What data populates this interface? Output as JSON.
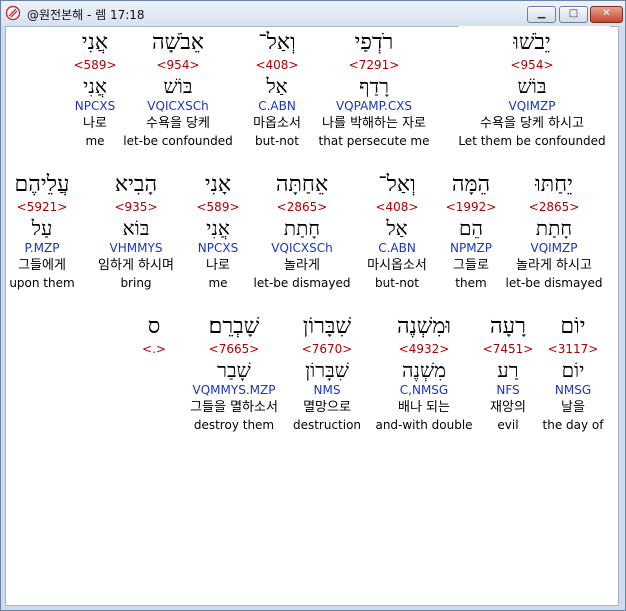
{
  "window": {
    "title": "@원전본해 - 렘 17:18",
    "minimize": "▁",
    "maximize": "□",
    "close": "✕"
  },
  "rows": [
    [
      {
        "heb": "אֲנִי",
        "strong": "<589>",
        "lemma": "אֲנִי",
        "morph": "NPCXS",
        "ko": "나로",
        "en": "me"
      },
      {
        "heb": "אֵבֹשָׁה",
        "strong": "<954>",
        "lemma": "בּוֹשׁ",
        "morph": "VQICXSCh",
        "ko": "수욕을 당케",
        "en": "let-be confounded"
      },
      {
        "heb": "וְאַל־",
        "strong": "<408>",
        "lemma": "אַל",
        "morph": "C.ABN",
        "ko": "마옵소서",
        "en": "but-not"
      },
      {
        "heb": "רֹדְפַי",
        "strong": "<7291>",
        "lemma": "רָדַף",
        "morph": "VQPAMP.CXS",
        "ko": "나를 박해하는 자로",
        "en": "that persecute me"
      },
      {
        "heb": "יֵבֹשׁוּ",
        "strong": "<954>",
        "lemma": "בּוֹשׁ",
        "morph": "VQIMZP",
        "ko": "수욕을 당케 하시고",
        "en": "Let them be confounded"
      }
    ],
    [
      {
        "heb": "עֲלֵיהֶם",
        "strong": "<5921>",
        "lemma": "עַל",
        "morph": "P.MZP",
        "ko": "그들에게",
        "en": "upon them"
      },
      {
        "heb": "הָבִיא",
        "strong": "<935>",
        "lemma": "בּוֹא",
        "morph": "VHMMYS",
        "ko": "임하게 하시며",
        "en": "bring"
      },
      {
        "heb": "אָנִי",
        "strong": "<589>",
        "lemma": "אֲנִי",
        "morph": "NPCXS",
        "ko": "나로",
        "en": "me"
      },
      {
        "heb": "אֵחַתָּה",
        "strong": "<2865>",
        "lemma": "חָתַת",
        "morph": "VQICXSCh",
        "ko": "놀라게",
        "en": "let-be dismayed"
      },
      {
        "heb": "וְאַל־",
        "strong": "<408>",
        "lemma": "אַל",
        "morph": "C.ABN",
        "ko": "마시옵소서",
        "en": "but-not"
      },
      {
        "heb": "הֵמָּה",
        "strong": "<1992>",
        "lemma": "הֵם",
        "morph": "NPMZP",
        "ko": "그들로",
        "en": "them"
      },
      {
        "heb": "יֵחַתּוּ",
        "strong": "<2865>",
        "lemma": "חָתַת",
        "morph": "VQIMZP",
        "ko": "놀라게 하시고",
        "en": "let-be dismayed"
      }
    ],
    [
      {
        "heb": "ס",
        "strong": "<.>",
        "lemma": "",
        "morph": "",
        "ko": "",
        "en": ""
      },
      {
        "heb": "שָׁבְרֵם׃",
        "strong": "<7665>",
        "lemma": "שָׁבַר",
        "morph": "VQMMYS.MZP",
        "ko": "그들을 멸하소서",
        "en": "destroy them"
      },
      {
        "heb": "שִׁבָּרוֹן",
        "strong": "<7670>",
        "lemma": "שִׁבָּרוֹן",
        "morph": "NMS",
        "ko": "멸망으로",
        "en": "destruction"
      },
      {
        "heb": "וּמִשְׁנֶה",
        "strong": "<4932>",
        "lemma": "מִשְׁנֶה",
        "morph": "C,NMSG",
        "ko": "배나 되는",
        "en": "and-with double"
      },
      {
        "heb": "רָעָה",
        "strong": "<7451>",
        "lemma": "רַע",
        "morph": "NFS",
        "ko": "재앙의",
        "en": "evil"
      },
      {
        "heb": "יוֹם",
        "strong": "<3117>",
        "lemma": "יוֹם",
        "morph": "NMSG",
        "ko": "날을",
        "en": "the day of"
      }
    ]
  ]
}
